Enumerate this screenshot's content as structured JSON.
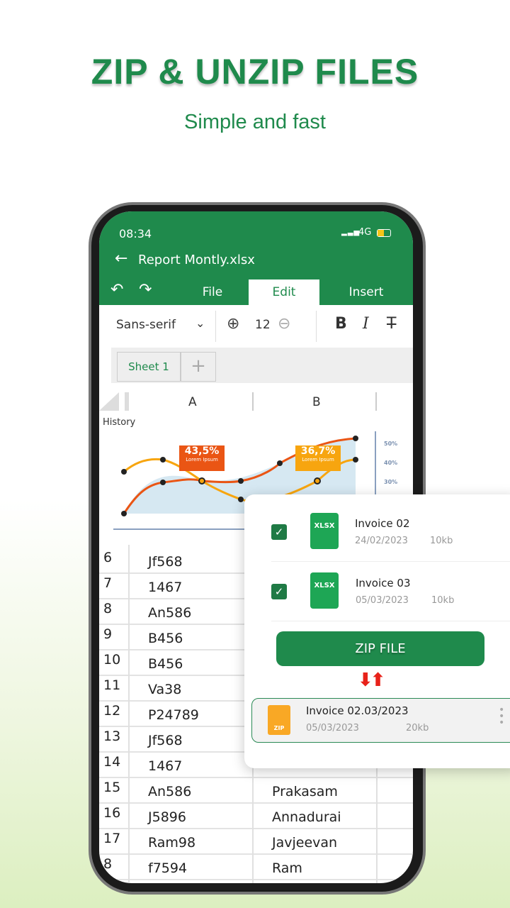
{
  "hero": {
    "title": "ZIP & UNZIP FILES",
    "subtitle": "Simple and fast"
  },
  "status": {
    "time": "08:34",
    "network": "4G"
  },
  "app": {
    "file_title": "Report Montly.xlsx",
    "tabs": [
      "File",
      "Edit",
      "Insert"
    ],
    "active_tab": "Edit"
  },
  "format": {
    "font": "Sans-serif",
    "size": "12"
  },
  "sheets": {
    "current": "Sheet 1"
  },
  "columns": [
    "A",
    "B"
  ],
  "chart": {
    "title": "History",
    "callouts": [
      {
        "value": "43,5%",
        "label": "Lorem Ipsum",
        "color": "#ea5514"
      },
      {
        "value": "36,7%",
        "label": "Lorem Ipsum",
        "color": "#f7a50f"
      }
    ],
    "yticks": [
      "50%",
      "40%",
      "30%"
    ]
  },
  "rows": [
    {
      "n": "6",
      "a": "Jf568",
      "b": ""
    },
    {
      "n": "7",
      "a": "1467",
      "b": ""
    },
    {
      "n": "8",
      "a": "An586",
      "b": ""
    },
    {
      "n": "9",
      "a": "B456",
      "b": ""
    },
    {
      "n": "10",
      "a": "B456",
      "b": ""
    },
    {
      "n": "11",
      "a": "Va38",
      "b": ""
    },
    {
      "n": "12",
      "a": "P24789",
      "b": ""
    },
    {
      "n": "13",
      "a": "Jf568",
      "b": ""
    },
    {
      "n": "14",
      "a": "1467",
      "b": ""
    },
    {
      "n": "15",
      "a": "An586",
      "b": "Prakasam"
    },
    {
      "n": "16",
      "a": "J5896",
      "b": "Annadurai"
    },
    {
      "n": "17",
      "a": "Ram98",
      "b": "Javjeevan"
    },
    {
      "n": "8",
      "a": "f7594",
      "b": "Ram"
    }
  ],
  "card": {
    "files": [
      {
        "name": "Invoice 02",
        "date": "24/02/2023",
        "size": "10kb",
        "type": "XLSX",
        "checked": true
      },
      {
        "name": "Invoice 03",
        "date": "05/03/2023",
        "size": "10kb",
        "type": "XLSX",
        "checked": true
      }
    ],
    "zip_button": "ZIP FILE",
    "zip_result": {
      "name": "Invoice 02.03/2023",
      "date": "05/03/2023",
      "size": "20kb",
      "type": "ZIP"
    }
  },
  "colors": {
    "brand": "#1f8a4c",
    "accent_orange": "#ea5514",
    "accent_yellow": "#f7a50f"
  }
}
